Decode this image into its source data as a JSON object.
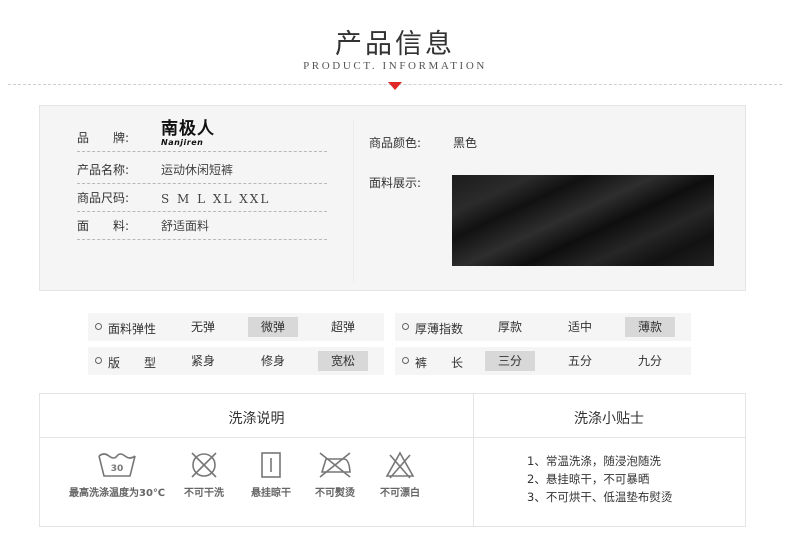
{
  "header": {
    "title_cn": "产品信息",
    "title_en": "PRODUCT. INFORMATION"
  },
  "product_info": {
    "brand_label": "品　　牌:",
    "brand_logo_cn": "南极人",
    "brand_logo_en": "Nanjiren",
    "name_label": "产品名称:",
    "name_value": "运动休闲短裤",
    "size_label": "商品尺码:",
    "size_value": "S  M  L  XL  XXL",
    "material_label": "面　　料:",
    "material_value": "舒适面料",
    "color_label": "商品颜色:",
    "color_value": "黑色",
    "fabric_label": "面料展示:",
    "fabric_swatch_color": "#1a1a1a"
  },
  "attributes": {
    "left": [
      {
        "name": "面料弹性",
        "options": [
          "无弹",
          "微弹",
          "超弹"
        ],
        "selected": 1
      },
      {
        "name": "版　　型",
        "options": [
          "紧身",
          "修身",
          "宽松"
        ],
        "selected": 2
      }
    ],
    "right": [
      {
        "name": "厚薄指数",
        "options": [
          "厚款",
          "适中",
          "薄款"
        ],
        "selected": 2
      },
      {
        "name": "裤　　长",
        "options": [
          "三分",
          "五分",
          "九分"
        ],
        "selected": 0
      }
    ]
  },
  "wash": {
    "instructions_title": "洗涤说明",
    "tips_title": "洗涤小贴士",
    "care_icons": [
      {
        "icon": "wash-30-icon",
        "label": "最高洗涤温度为30℃",
        "number": "30"
      },
      {
        "icon": "no-dry-clean-icon",
        "label": "不可干洗"
      },
      {
        "icon": "hang-dry-icon",
        "label": "悬挂晾干"
      },
      {
        "icon": "no-iron-icon",
        "label": "不可熨烫"
      },
      {
        "icon": "no-bleach-icon",
        "label": "不可漂白"
      }
    ],
    "tips": [
      "1、常温洗涤，随浸泡随洗",
      "2、悬挂晾干，不可暴晒",
      "3、不可烘干、低温垫布熨烫"
    ]
  },
  "colors": {
    "accent_arrow": "#e02828",
    "panel_bg": "#f5f5f5",
    "selected_option_bg": "#d8d8d8"
  }
}
